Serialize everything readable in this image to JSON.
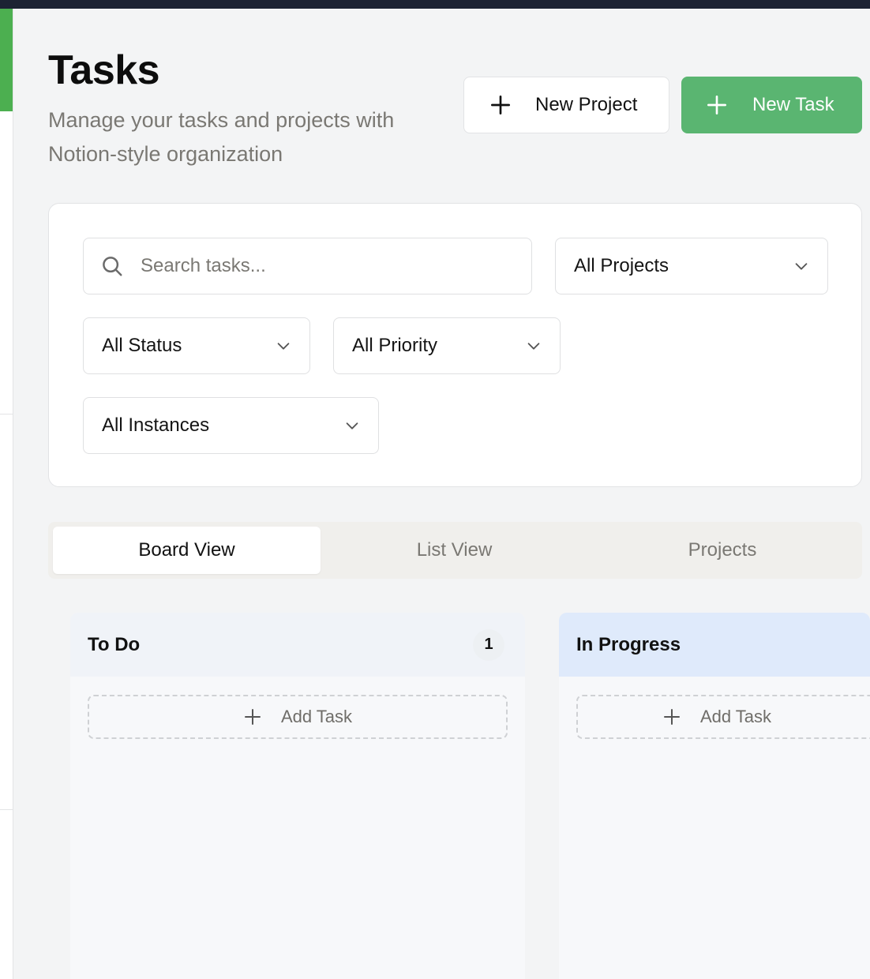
{
  "header": {
    "title": "Tasks",
    "subtitle": "Manage your tasks and projects with Notion-style organization",
    "new_project_label": "New Project",
    "new_task_label": "New Task"
  },
  "filters": {
    "search_placeholder": "Search tasks...",
    "project_selected": "All Projects",
    "status_selected": "All Status",
    "priority_selected": "All Priority",
    "instance_selected": "All Instances"
  },
  "tabs": [
    {
      "label": "Board View",
      "active": true
    },
    {
      "label": "List View",
      "active": false
    },
    {
      "label": "Projects",
      "active": false
    }
  ],
  "board": {
    "columns": [
      {
        "title": "To Do",
        "count": "1",
        "add_label": "Add Task"
      },
      {
        "title": "In Progress",
        "add_label": "Add Task"
      }
    ]
  },
  "colors": {
    "accent_green": "#5ab571",
    "topbar": "#1c2333",
    "in_progress_header": "#dfeafb"
  },
  "icons": [
    "plus-icon",
    "search-icon",
    "chevron-down-icon"
  ]
}
